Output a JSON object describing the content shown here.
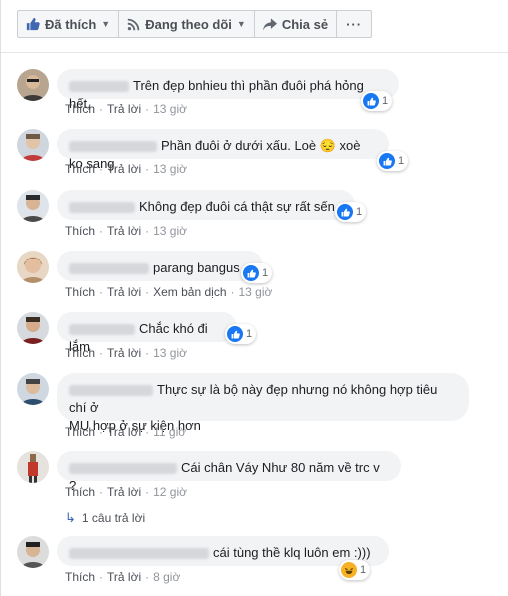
{
  "toolbar": {
    "like_label": "Đã thích",
    "follow_label": "Đang theo dõi",
    "share_label": "Chia sẻ",
    "more_label": "···"
  },
  "action_labels": {
    "like": "Thích",
    "reply": "Trả lời",
    "translate": "Xem bản dịch"
  },
  "comments": [
    {
      "text": "Trên đẹp bnhieu thì phần đuôi phá hỏng hết,",
      "reaction": "like",
      "count": "1",
      "time": "13 giờ"
    },
    {
      "text": "Phần đuôi ở dưới xấu. Loè 😔 xoè ko sang",
      "reaction": "like",
      "count": "1",
      "time": "13 giờ"
    },
    {
      "text": "Không đẹp đuôi cá thật sự rất sến",
      "reaction": "like",
      "count": "1",
      "time": "13 giờ"
    },
    {
      "text": "parang bangus",
      "reaction": "like",
      "count": "1",
      "time": "13 giờ",
      "translate": true
    },
    {
      "text": "Chắc khó đi lắm",
      "reaction": "like",
      "count": "1",
      "time": "13 giờ"
    },
    {
      "text_line1": "Thực sự là bộ này đẹp nhưng nó không hợp tiêu chí ở",
      "text_line2": "MU hợp ở sự kiện hơn",
      "time": "11 giờ"
    },
    {
      "text": "Cái chân Váy Như 80 năm về trc v ?",
      "time": "12 giờ",
      "replies": "1 câu trả lời"
    },
    {
      "text": "cái tùng thề klq luôn em :)))",
      "reaction": "haha",
      "count": "1",
      "time": "8 giờ"
    }
  ],
  "colors": {
    "like": "#1877f2",
    "haha": "#f7b125",
    "bubble": "#f2f3f5"
  }
}
